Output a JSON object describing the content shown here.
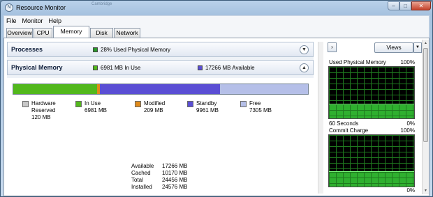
{
  "window": {
    "title": "Resource Monitor",
    "app_icon_glyph": "N",
    "ghost_text": "Cambridge"
  },
  "menu": [
    "File",
    "Monitor",
    "Help"
  ],
  "tabs": [
    "Overview",
    "CPU",
    "Memory",
    "Disk",
    "Network"
  ],
  "active_tab": "Memory",
  "processes": {
    "title": "Processes",
    "summary": "28% Used Physical Memory",
    "indicator_color": "#2a9a2a"
  },
  "physical_memory": {
    "title": "Physical Memory",
    "in_use_summary": "6981 MB In Use",
    "available_summary": "17266 MB Available",
    "segments": [
      {
        "name": "In Use",
        "color": "#52b81c",
        "mb": 6981
      },
      {
        "name": "Modified",
        "color": "#e08a1a",
        "mb": 209
      },
      {
        "name": "Standby",
        "color": "#5a4ed4",
        "mb": 9961
      },
      {
        "name": "Free",
        "color": "#b5bfe8",
        "mb": 7305
      }
    ],
    "legend": {
      "hardware": {
        "name": "Hardware",
        "sub": "Reserved",
        "value": "120 MB",
        "color": "#c8c8c8"
      },
      "in_use": {
        "name": "In Use",
        "value": "6981 MB",
        "color": "#52b81c"
      },
      "modified": {
        "name": "Modified",
        "value": "209 MB",
        "color": "#e08a1a"
      },
      "standby": {
        "name": "Standby",
        "value": "9961 MB",
        "color": "#5a4ed4"
      },
      "free": {
        "name": "Free",
        "value": "7305 MB",
        "color": "#b5bfe8"
      }
    },
    "stats": [
      {
        "label": "Available",
        "value": "17266 MB"
      },
      {
        "label": "Cached",
        "value": "10170 MB"
      },
      {
        "label": "Total",
        "value": "24456 MB"
      },
      {
        "label": "Installed",
        "value": "24576 MB"
      }
    ]
  },
  "right_pane": {
    "expand_icon": "chevron-right-icon",
    "views_label": "Views",
    "graphs": [
      {
        "title": "Used Physical Memory",
        "max_label": "100%",
        "footer_left": "60 Seconds",
        "min_label": "0%",
        "level_pct": 28
      },
      {
        "title": "Commit Charge",
        "max_label": "100%",
        "footer_left": "",
        "min_label": "0%",
        "level_pct": 30
      }
    ]
  }
}
